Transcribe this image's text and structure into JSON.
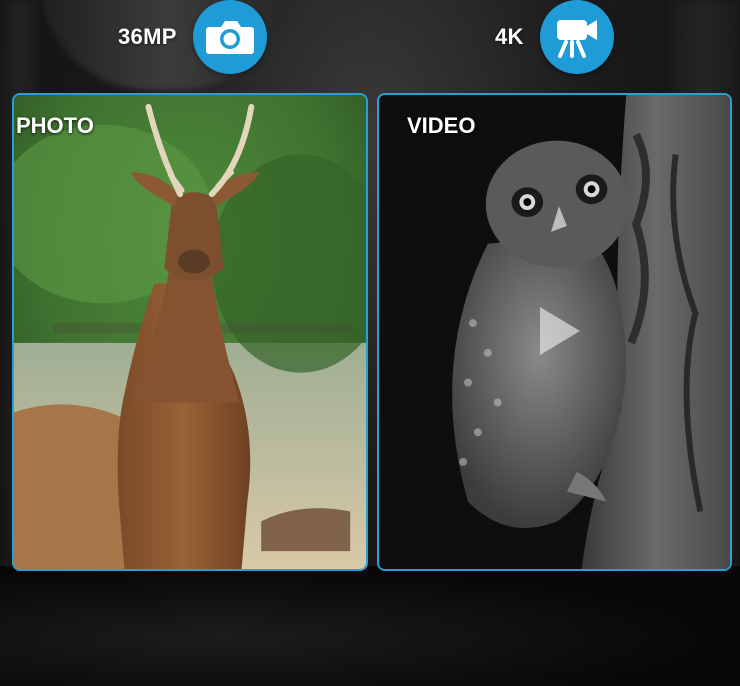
{
  "specs": {
    "photo_resolution": "36MP",
    "video_resolution": "4K",
    "photo_icon": "camera-icon",
    "video_icon": "video-camera-icon"
  },
  "panels": {
    "photo_label": "PHOTO",
    "video_label": "VIDEO"
  },
  "colors": {
    "accent": "#1f9bd8",
    "border": "#2a9fd6"
  }
}
